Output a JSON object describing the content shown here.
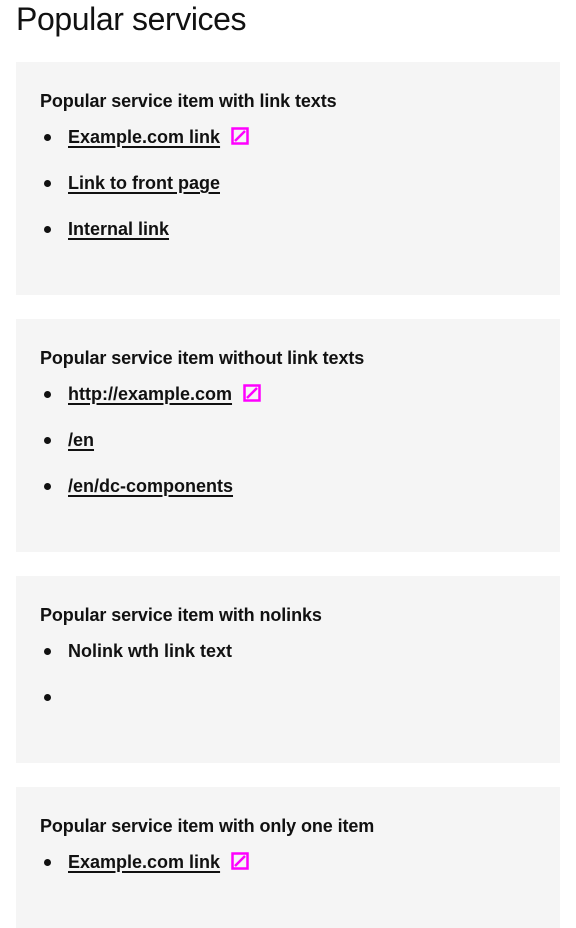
{
  "page": {
    "title": "Popular services"
  },
  "cards": [
    {
      "title": "Popular service item with link texts",
      "items": [
        {
          "text": "Example.com link",
          "external": true
        },
        {
          "text": "Link to front page",
          "external": false
        },
        {
          "text": "Internal link",
          "external": false
        }
      ]
    },
    {
      "title": "Popular service item without link texts",
      "items": [
        {
          "text": "http://example.com",
          "external": true
        },
        {
          "text": "/en",
          "external": false
        },
        {
          "text": "/en/dc-components",
          "external": false
        }
      ]
    },
    {
      "title": "Popular service item with nolinks",
      "items": [
        {
          "text": "Nolink wth link text"
        },
        {
          "text": ""
        }
      ]
    },
    {
      "title": "Popular service item with only one item",
      "items": [
        {
          "text": "Example.com link",
          "external": true
        }
      ]
    }
  ],
  "colors": {
    "text": "#111111",
    "card_background": "#f5f5f5",
    "external_icon": "#ff00ff"
  },
  "icons": {
    "external": "external-link-icon",
    "bullet": "bullet-dot"
  }
}
